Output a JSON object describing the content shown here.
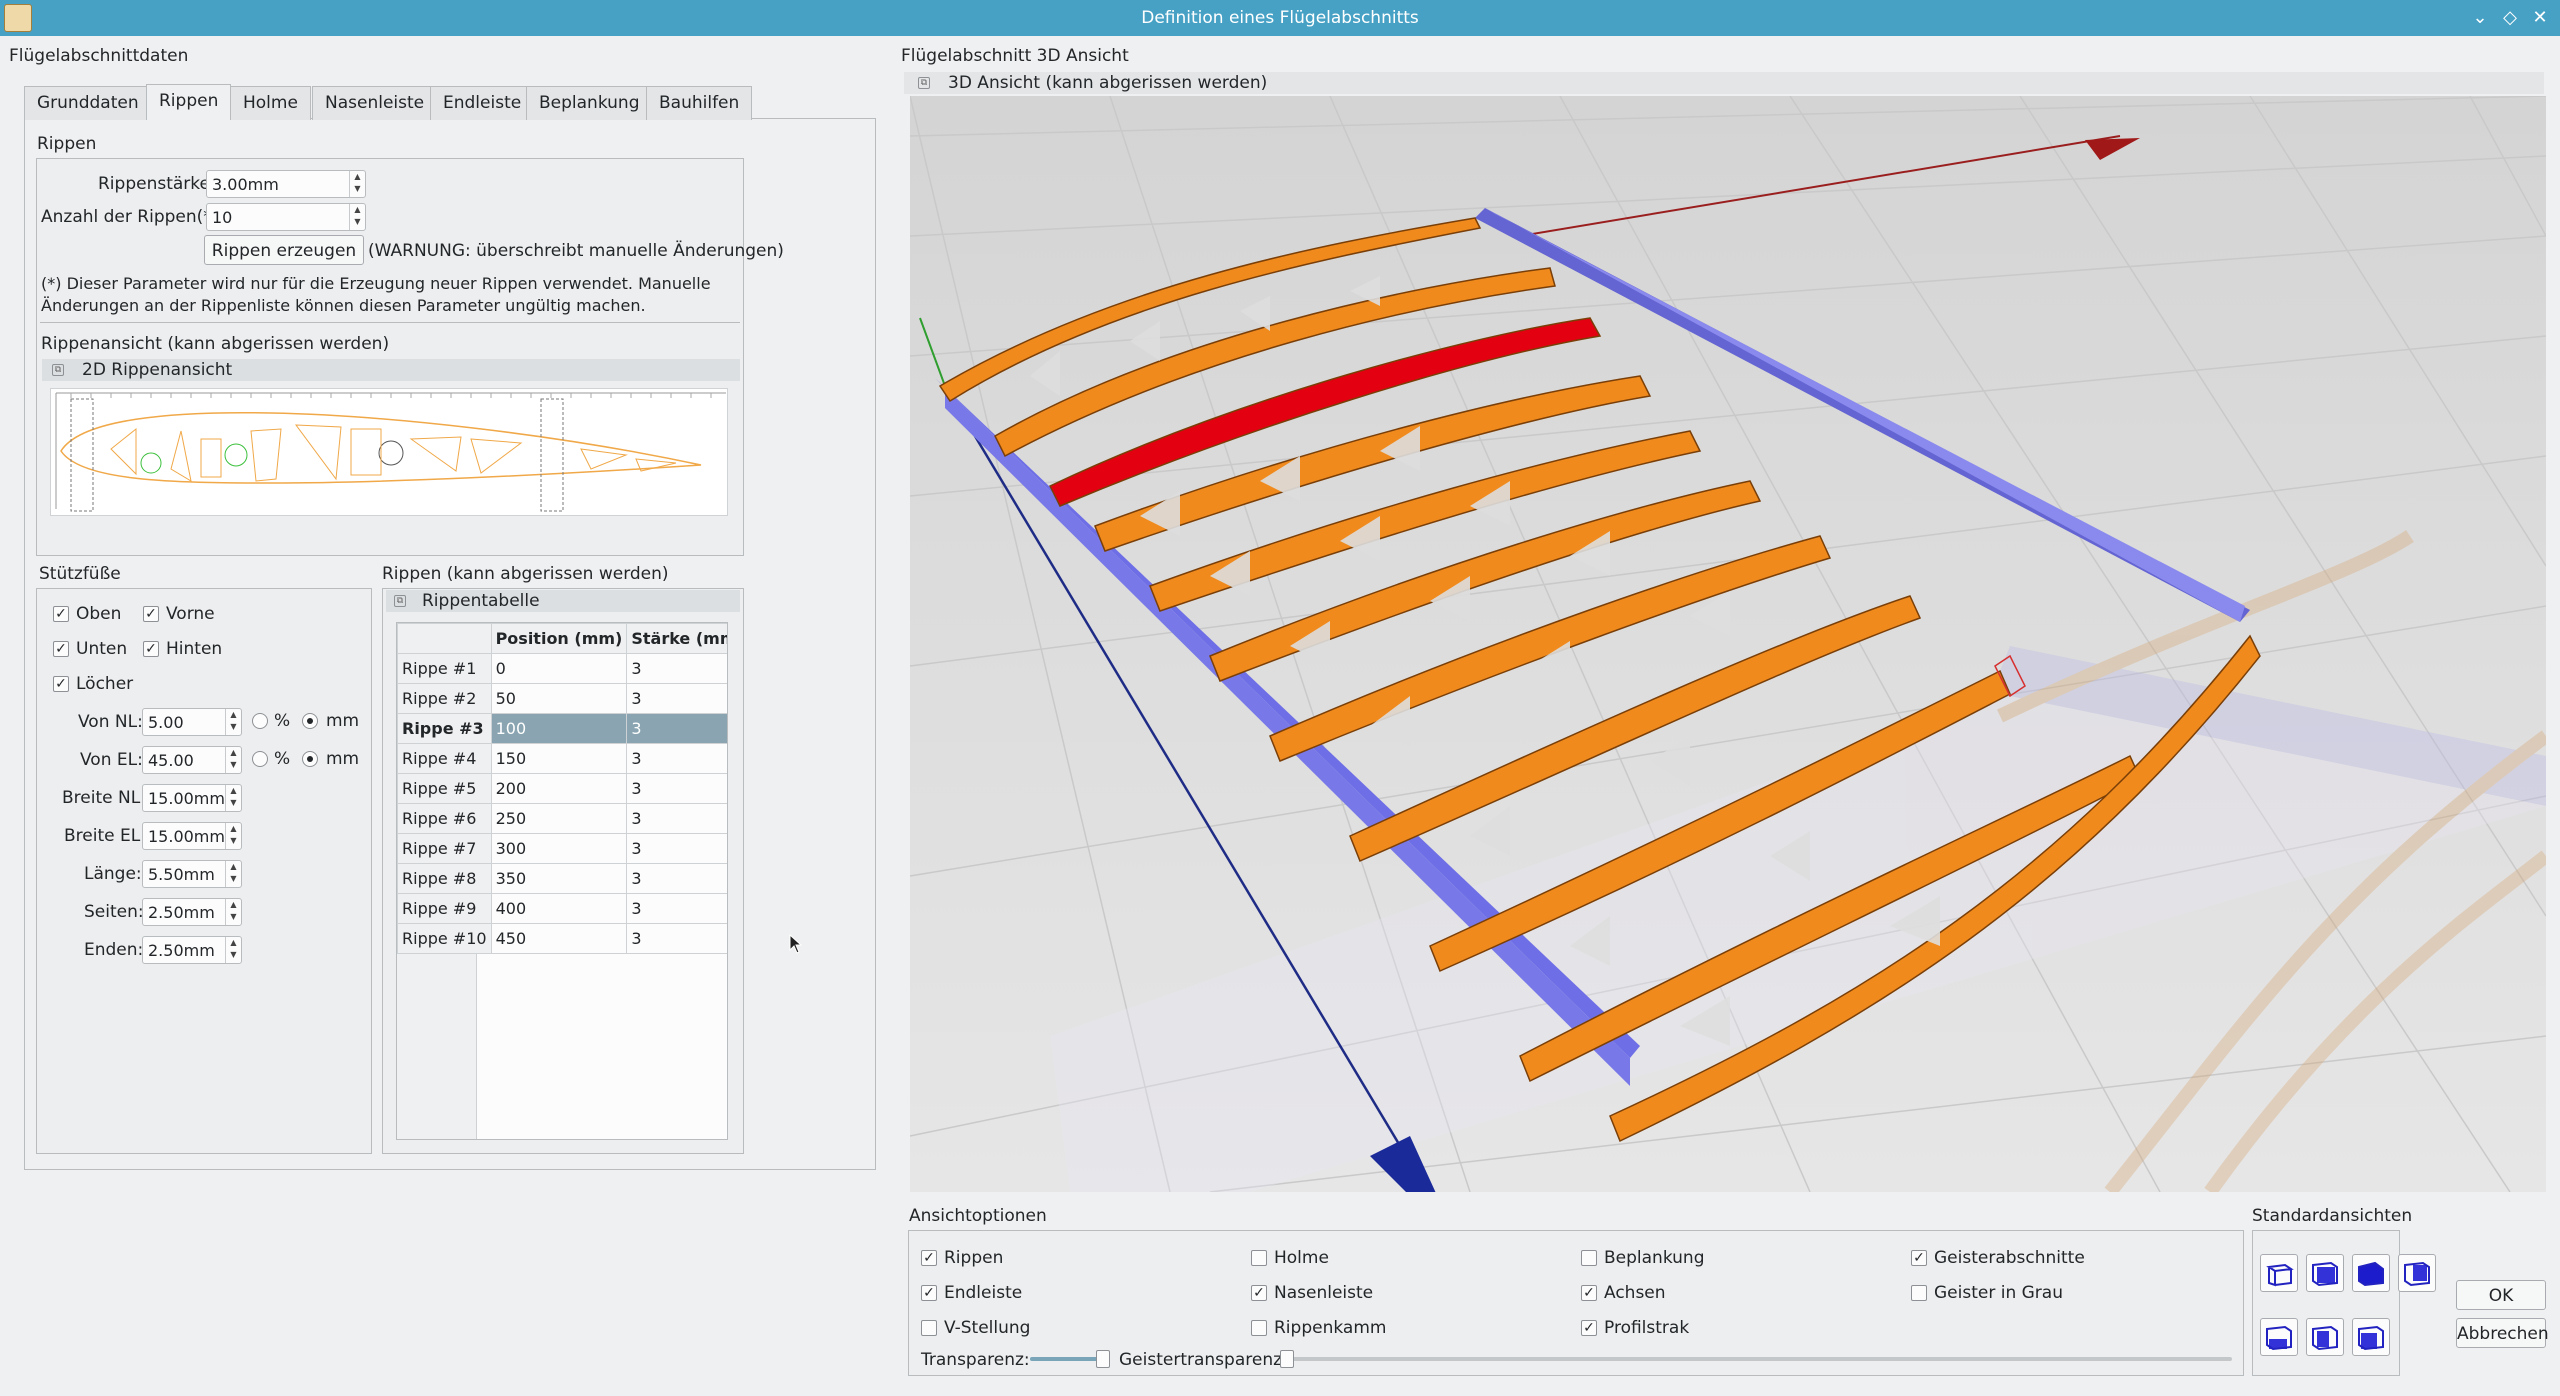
{
  "window": {
    "title": "Definition eines Flügelabschnitts"
  },
  "left": {
    "heading": "Flügelabschnittdaten",
    "tabs": [
      "Grunddaten",
      "Rippen",
      "Holme",
      "Nasenleiste",
      "Endleiste",
      "Beplankung",
      "Bauhilfen"
    ],
    "active_tab": "Rippen",
    "rippen": {
      "title": "Rippen",
      "thickness_label": "Rippenstärke:",
      "thickness_value": "3.00mm",
      "count_label": "Anzahl der Rippen(*):",
      "count_value": "10",
      "generate_button": "Rippen erzeugen",
      "warning": "(WARNUNG: überschreibt manuelle Änderungen)",
      "note_line1": "(*) Dieser Parameter wird nur für die Erzeugung neuer Rippen verwendet. Manuelle",
      "note_line2": "Änderungen an der Rippenliste können diesen Parameter ungültig machen.",
      "view_section": "Rippenansicht (kann abgerissen werden)",
      "view_dock": "2D Rippenansicht"
    },
    "stuetzfuesse": {
      "title": "Stützfüße",
      "oben": "Oben",
      "vorne": "Vorne",
      "unten": "Unten",
      "hinten": "Hinten",
      "loecher": "Löcher",
      "von_nl_label": "Von NL:",
      "von_nl_value": "5.00",
      "von_el_label": "Von EL:",
      "von_el_value": "45.00",
      "percent": "%",
      "mm": "mm",
      "breite_nl_label": "Breite NL:",
      "breite_nl_value": "15.00mm",
      "breite_el_label": "Breite EL:",
      "breite_el_value": "15.00mm",
      "laenge_label": "Länge:",
      "laenge_value": "5.50mm",
      "seiten_label": "Seiten:",
      "seiten_value": "2.50mm",
      "enden_label": "Enden:",
      "enden_value": "2.50mm"
    },
    "ribs_table": {
      "section": "Rippen (kann abgerissen werden)",
      "dock": "Rippentabelle",
      "col_position": "Position (mm)",
      "col_staerke": "Stärke (mm)",
      "selected_row": 2,
      "rows": [
        {
          "name": "Rippe #1",
          "position": "0",
          "staerke": "3"
        },
        {
          "name": "Rippe #2",
          "position": "50",
          "staerke": "3"
        },
        {
          "name": "Rippe #3",
          "position": "100",
          "staerke": "3"
        },
        {
          "name": "Rippe #4",
          "position": "150",
          "staerke": "3"
        },
        {
          "name": "Rippe #5",
          "position": "200",
          "staerke": "3"
        },
        {
          "name": "Rippe #6",
          "position": "250",
          "staerke": "3"
        },
        {
          "name": "Rippe #7",
          "position": "300",
          "staerke": "3"
        },
        {
          "name": "Rippe #8",
          "position": "350",
          "staerke": "3"
        },
        {
          "name": "Rippe #9",
          "position": "400",
          "staerke": "3"
        },
        {
          "name": "Rippe #10",
          "position": "450",
          "staerke": "3"
        }
      ]
    }
  },
  "right": {
    "heading": "Flügelabschnitt 3D Ansicht",
    "dock": "3D Ansicht (kann abgerissen werden)",
    "options": {
      "title": "Ansichtoptionen",
      "rippen": "Rippen",
      "holme": "Holme",
      "beplankung": "Beplankung",
      "geisterabschnitte": "Geisterabschnitte",
      "endleiste": "Endleiste",
      "nasenleiste": "Nasenleiste",
      "achsen": "Achsen",
      "geister_grau": "Geister in Grau",
      "v_stellung": "V-Stellung",
      "rippenkamm": "Rippenkamm",
      "profilstrak": "Profilstrak",
      "transparenz": "Transparenz:",
      "geistertransparenz": "Geistertransparenz:"
    },
    "standard_views": "Standardansichten",
    "ok": "OK",
    "cancel": "Abbrechen"
  },
  "colors": {
    "titlebar": "#47a1c5",
    "rib": "#f08a1c",
    "rib_selected": "#e30010",
    "spar": "#7878e8",
    "selection": "#8aa5b1"
  }
}
